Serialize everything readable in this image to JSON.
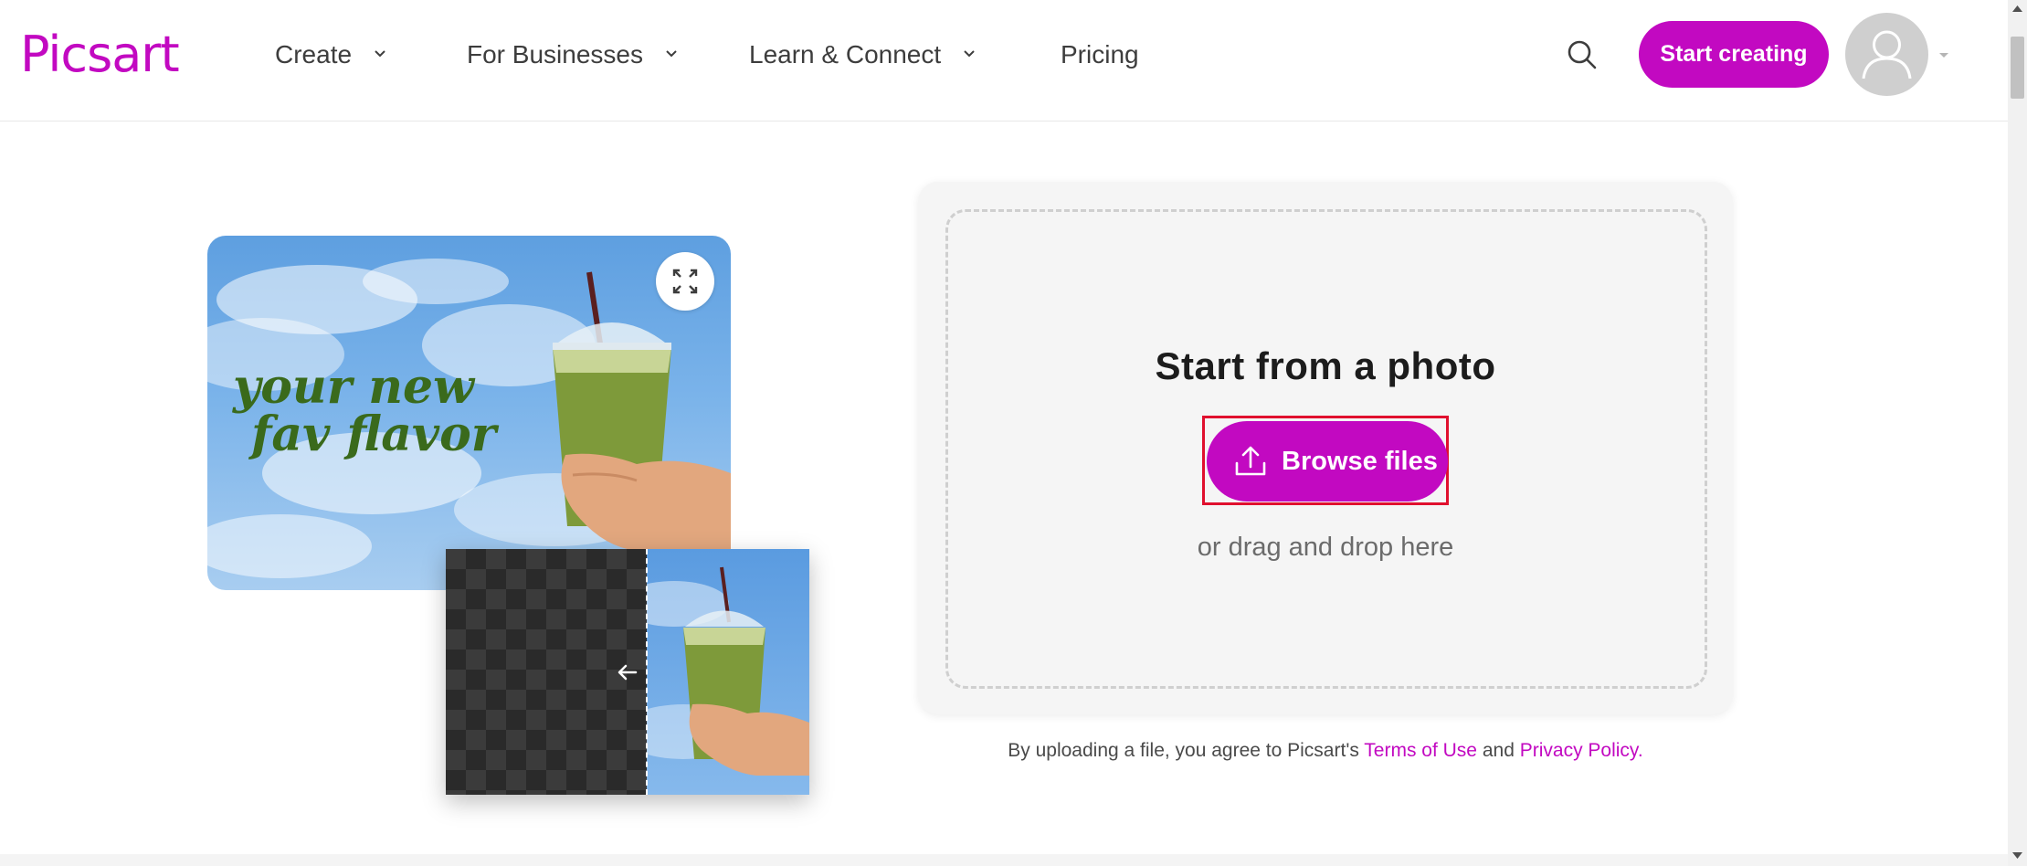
{
  "header": {
    "logo_text": "Picsart",
    "nav": [
      {
        "label": "Create",
        "has_dropdown": true
      },
      {
        "label": "For Businesses",
        "has_dropdown": true
      },
      {
        "label": "Learn & Connect",
        "has_dropdown": true
      },
      {
        "label": "Pricing",
        "has_dropdown": false
      }
    ],
    "search_icon": "search-icon",
    "cta_label": "Start creating",
    "avatar_icon": "user-avatar-icon"
  },
  "illustration": {
    "promo_line1": "your new",
    "promo_line2": "fav flavor",
    "expand_icon": "expand-icon",
    "compare_arrow_icon": "arrow-left-icon"
  },
  "upload": {
    "title": "Start from a photo",
    "browse_label": "Browse files",
    "browse_icon": "upload-icon",
    "drag_text": "or drag and drop here"
  },
  "legal": {
    "prefix": "By uploading a file, you agree to Picsart's",
    "terms_link": "Terms of Use",
    "and": "and",
    "privacy_link": "Privacy Policy."
  },
  "colors": {
    "brand": "#c209c1",
    "highlight": "#e0102e",
    "panel_bg": "#f5f5f5"
  }
}
